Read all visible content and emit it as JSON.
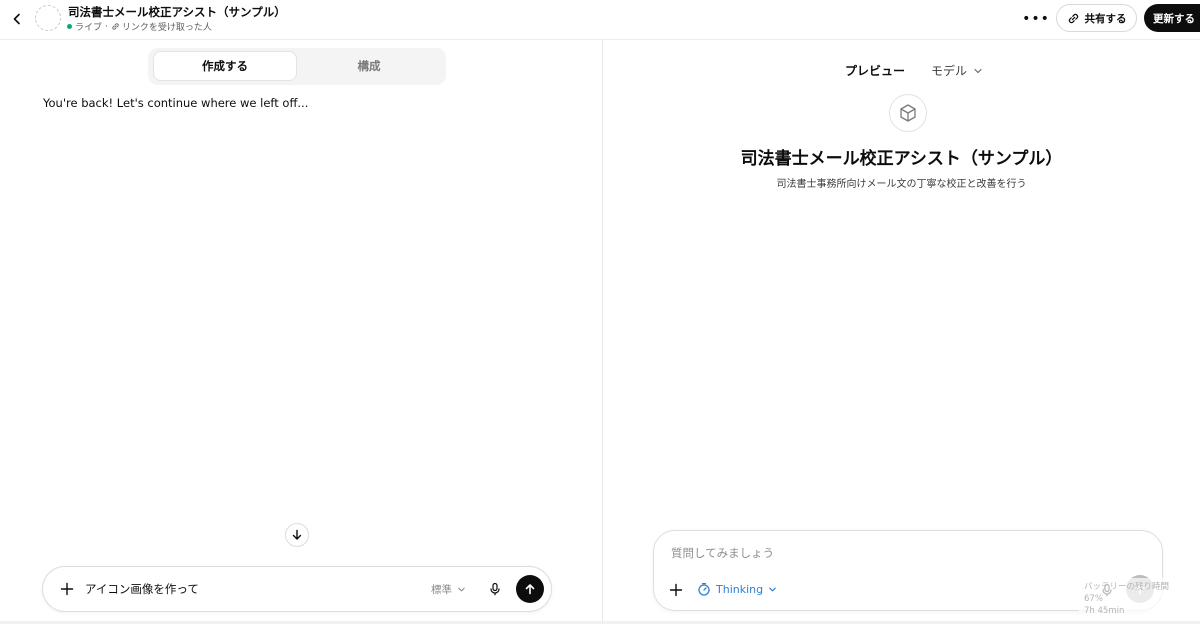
{
  "header": {
    "gpt_name": "司法書士メール校正アシスト（サンプル）",
    "status_live": "ライブ",
    "status_separator": "·",
    "status_visibility": "リンクを受け取った人",
    "share_label": "共有する",
    "update_label": "更新する"
  },
  "editor": {
    "tabs": [
      {
        "label": "作成する",
        "active": true
      },
      {
        "label": "構成",
        "active": false
      }
    ],
    "welcome_message": "You're back! Let's continue where we left off...",
    "composer": {
      "text": "アイコン画像を作って",
      "mode_label": "標準"
    }
  },
  "preview": {
    "tab_preview": "プレビュー",
    "tab_model": "モデル",
    "gpt_title": "司法書士メール校正アシスト（サンプル）",
    "gpt_description": "司法書士事務所向けメール文の丁寧な校正と改善を行う",
    "composer": {
      "placeholder": "質問してみましょう",
      "thinking_label": "Thinking"
    }
  },
  "battery_overlay": {
    "line1": "バッテリーの残り時間 67%",
    "line2": "7h 45min"
  },
  "colors": {
    "accent_blue": "#2f7fd6",
    "live_green": "#10a37f",
    "dark": "#0d0d0d"
  },
  "icons": [
    "chevron-left-icon",
    "link-icon",
    "more-icon",
    "plus-icon",
    "mic-icon",
    "arrow-up-icon",
    "arrow-down-icon",
    "cube-icon",
    "timer-icon",
    "chevron-down-icon"
  ]
}
